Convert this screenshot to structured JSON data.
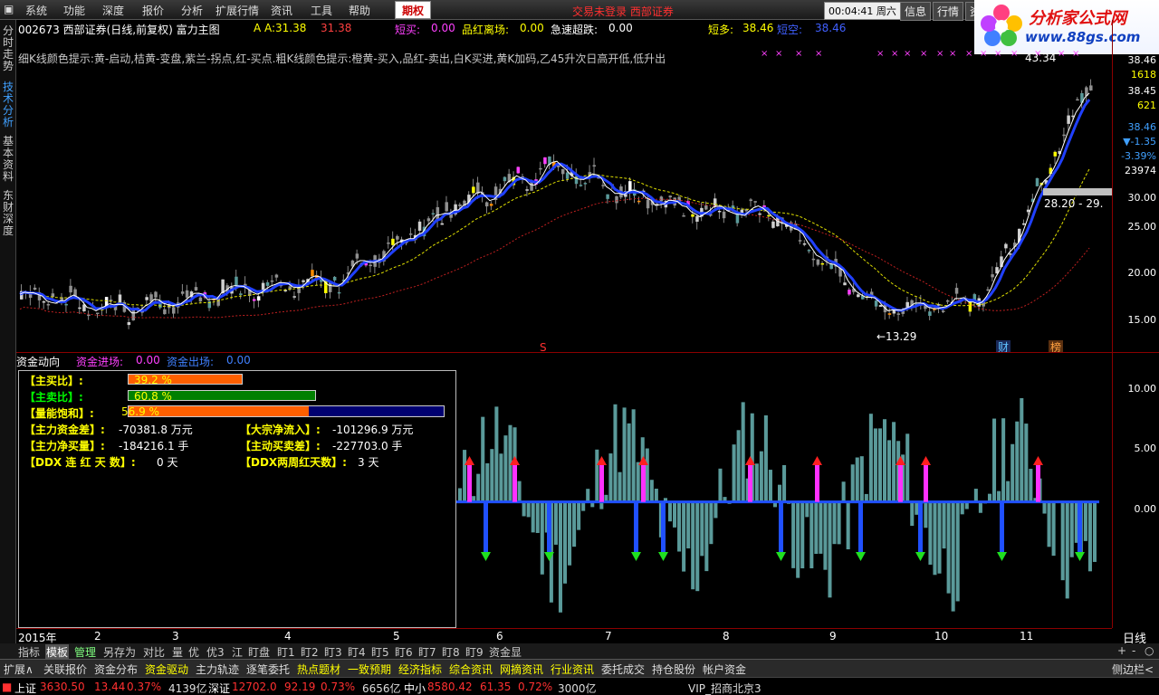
{
  "menu": {
    "items": [
      "系统",
      "功能",
      "深度",
      "报价",
      "分析",
      "扩展行情",
      "资讯",
      "工具",
      "帮助"
    ],
    "qiquan": "期权",
    "notice": "交易未登录   西部证券",
    "clock": "00:04:41",
    "weekday": "周六",
    "right_buttons": [
      "信息",
      "行情",
      "资"
    ]
  },
  "logo": {
    "title": "分析家公式网",
    "url": "www.88gs.com"
  },
  "vtabs": [
    "分时走势",
    "技术分析",
    "基本资料",
    "东财深度"
  ],
  "header": {
    "code_name": "002673 西部证券(日线,前复权) 富力主图",
    "a_label": "A A:",
    "a_val1": "31.38",
    "a_val2": "31.38",
    "k1_label": "短买:",
    "k1_val": "0.00",
    "k2_label": "品红离场:",
    "k2_val": "0.00",
    "k3_label": "急速超跌:",
    "k3_val": "0.00",
    "k4_label": "短多:",
    "k4_val": "38.46",
    "k5_label": "短空:",
    "k5_val": "38.46"
  },
  "hint": "细K线颜色提示:黄-启动,桔黄-变盘,紫兰-拐点,红-买点.粗K线颜色提示:橙黄-买入,品红-卖出,白K买进,黄K加码,乙45升次日高开低,低升出",
  "price_axis": {
    "ticks": [
      "30.00",
      "25.00",
      "20.00",
      "15.00"
    ],
    "side_values": [
      {
        "text": "38.46",
        "color": "#ffffff"
      },
      {
        "text": "1618",
        "color": "#ffff00"
      },
      {
        "text": "38.45",
        "color": "#ffffff"
      },
      {
        "text": "621",
        "color": "#ffff00"
      },
      {
        "text": "38.46",
        "color": "#40a0ff"
      },
      {
        "text": "▼-1.35",
        "color": "#40a0ff"
      },
      {
        "text": "-3.39%",
        "color": "#40a0ff"
      },
      {
        "text": "23974",
        "color": "#ffffff"
      }
    ]
  },
  "annotations": {
    "high": "43.34",
    "low": "←13.29",
    "range": "28.20 - 29.",
    "s_marker": "S",
    "cai": "财",
    "bang": "榜"
  },
  "chart_data": [
    {
      "type": "line",
      "x": [
        "2015年",
        "2",
        "3",
        "4",
        "5",
        "6",
        "7",
        "8",
        "9",
        "10",
        "11"
      ],
      "series": [
        {
          "values": [
            17.0,
            15.5,
            17.5,
            18.5,
            25.5,
            30.0,
            26.0,
            25.0,
            15.5,
            16.5,
            38.5
          ]
        }
      ],
      "ylim": [
        12,
        42
      ]
    },
    {
      "type": "bar",
      "title": "资金动向",
      "x": [
        "6",
        "7",
        "8",
        "9",
        "10",
        "11"
      ],
      "series": [
        {
          "name": "资金进场",
          "values": [
            0.0
          ]
        },
        {
          "name": "资金出场",
          "values": [
            0.0
          ]
        }
      ],
      "yticks": [
        "10.00",
        "5.00",
        "0.00"
      ],
      "ylim": [
        -11,
        13
      ]
    }
  ],
  "flow": {
    "title": "资金动向",
    "in_label": "资金进场:",
    "in_val": "0.00",
    "out_label": "资金出场:",
    "out_val": "0.00",
    "axis": [
      "10.00",
      "5.00",
      "0.00"
    ]
  },
  "panel": {
    "buy_label": "【主买比】:",
    "buy_val": "39.2  %",
    "buy_pct": 39.2,
    "sell_label": "【主卖比】:",
    "sell_val": "60.8  %",
    "sell_pct": 60.8,
    "sat_label": "【量能饱和】:",
    "sat_val": "56.9  %",
    "sat_pct": 56.9,
    "r1a_label": "【主力资金差】:",
    "r1a_val": "-70381.8 万元",
    "r1b_label": "【大宗净流入】:",
    "r1b_val": "-101296.9 万元",
    "r2a_label": "【主力净买量】:",
    "r2a_val": "-184216.1 手",
    "r2b_label": "【主动买卖差】:",
    "r2b_val": "-227703.0 手",
    "r3a_label": "【DDX 连 红 天 数】:",
    "r3a_val": "0  天",
    "r3b_label": "【DDX两周红天数】:",
    "r3b_val": "3  天"
  },
  "xaxis": {
    "labels": [
      "2015年",
      "2",
      "3",
      "4",
      "5",
      "6",
      "7",
      "8",
      "9",
      "10",
      "11"
    ],
    "period": "日线"
  },
  "indicator_tabs": [
    "指标",
    "模板",
    "管理",
    "另存为",
    "对比",
    "量",
    "优",
    "优3",
    "江",
    "盯盘",
    "盯1",
    "盯2",
    "盯3",
    "盯4",
    "盯5",
    "盯6",
    "盯7",
    "盯8",
    "盯9",
    "资金显"
  ],
  "indicator_controls": [
    "+",
    "-",
    "○"
  ],
  "function_tabs": [
    "扩展∧",
    "关联报价",
    "资金分布",
    "资金驱动",
    "主力轨迹",
    "逐笔委托",
    "热点题材",
    "一致预期",
    "经济指标",
    "综合资讯",
    "网摘资讯",
    "行业资讯",
    "委托成交",
    "持仓股份",
    "帐户资金"
  ],
  "function_right": "侧边栏<",
  "status": {
    "sh_label": "上证",
    "sh_val": "3630.50",
    "sh_chg": "13.44",
    "sh_pct": "0.37%",
    "sh_amt": "4139亿",
    "sz_label": "深证",
    "sz_val": "12702.0",
    "sz_chg": "92.19",
    "sz_pct": "0.73%",
    "sz_amt": "6656亿",
    "zx_label": "中小",
    "zx_val": "8580.42",
    "zx_chg": "61.35",
    "zx_pct": "0.72%",
    "zx_amt": "3000亿",
    "vip": "VIP_招商北京3"
  }
}
